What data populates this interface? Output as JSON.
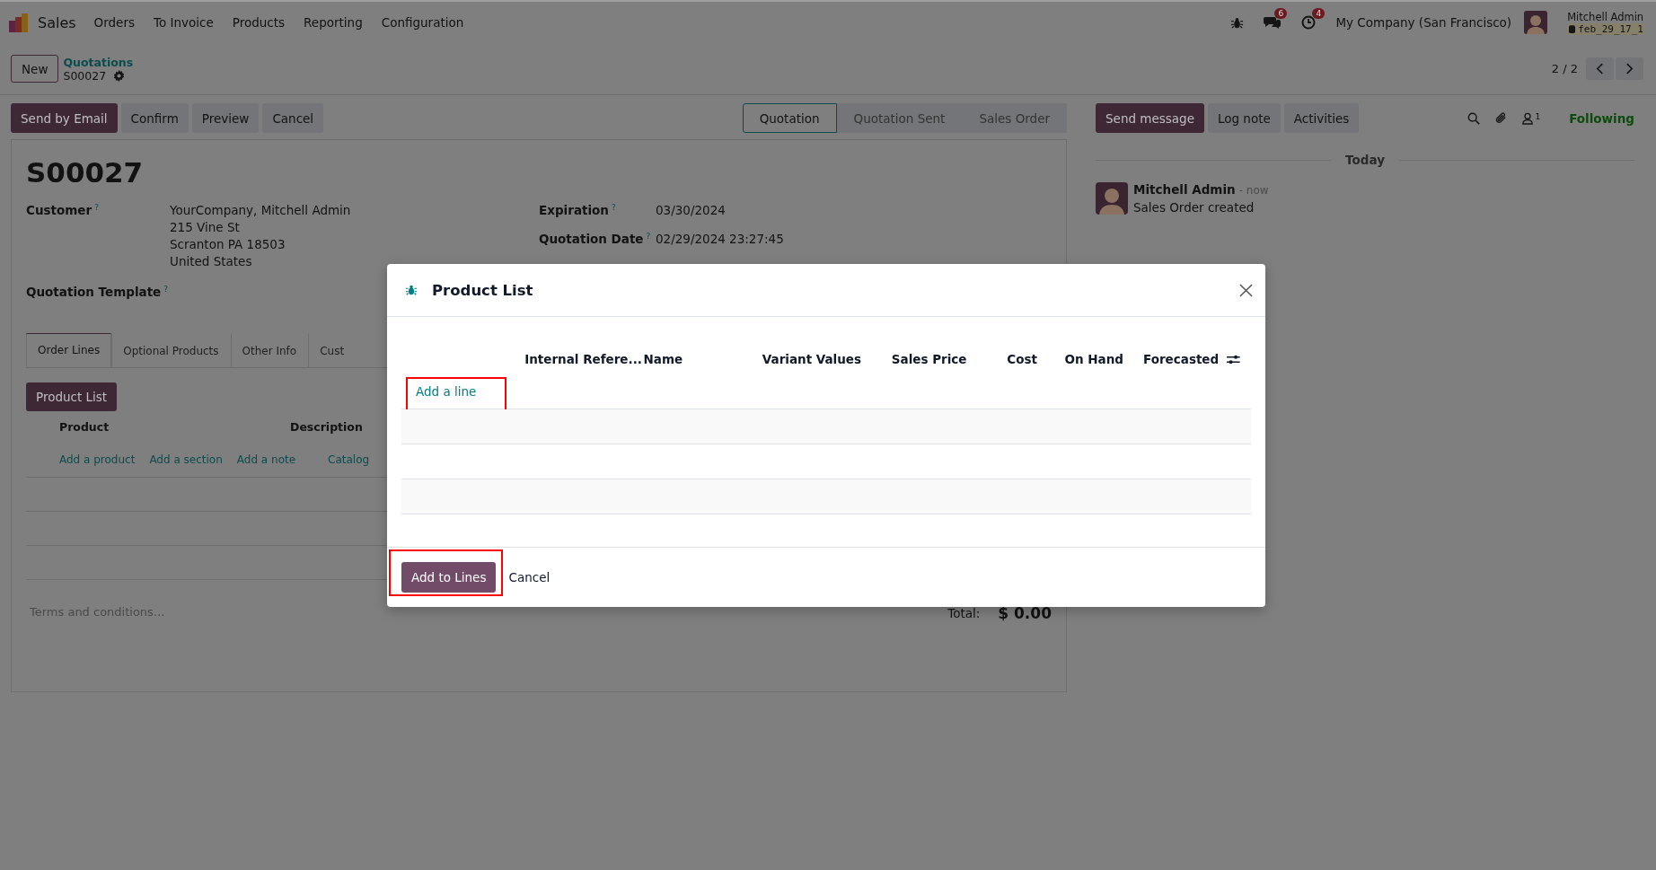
{
  "navbar": {
    "app": "Sales",
    "menu": [
      "Orders",
      "To Invoice",
      "Products",
      "Reporting",
      "Configuration"
    ],
    "chat_count": "6",
    "activity_count": "4",
    "company": "My Company (San Francisco)",
    "user": "Mitchell Admin",
    "database": "feb_29_17_1"
  },
  "control_panel": {
    "new_button": "New",
    "breadcrumb_parent": "Quotations",
    "breadcrumb_current": "S00027",
    "pager": "2 / 2"
  },
  "actions": [
    {
      "label": "Send by Email",
      "kind": "primary"
    },
    {
      "label": "Confirm",
      "kind": "secondary"
    },
    {
      "label": "Preview",
      "kind": "secondary"
    },
    {
      "label": "Cancel",
      "kind": "secondary"
    }
  ],
  "status_steps": [
    {
      "label": "Quotation",
      "selected": true
    },
    {
      "label": "Quotation Sent",
      "selected": false
    },
    {
      "label": "Sales Order",
      "selected": false
    }
  ],
  "form": {
    "title": "S00027",
    "left_fields": [
      {
        "label": "Customer",
        "help": "?",
        "lines": [
          "YourCompany, Mitchell Admin",
          "215 Vine St",
          "Scranton PA 18503",
          "United States"
        ]
      },
      {
        "label": "Quotation Template",
        "help": "?"
      }
    ],
    "right_fields": [
      {
        "label": "Expiration",
        "help": "?",
        "value": "03/30/2024"
      },
      {
        "label": "Quotation Date",
        "help": "?",
        "value": "02/29/2024 23:27:45"
      }
    ],
    "tabs": [
      {
        "label": "Order Lines",
        "selected": true
      },
      {
        "label": "Optional Products",
        "selected": false
      },
      {
        "label": "Other Info",
        "selected": false
      },
      {
        "label": "Cust",
        "selected": false
      }
    ],
    "product_list_button": "Product List",
    "columns": [
      "Product",
      "Description"
    ],
    "add_links": [
      "Add a product",
      "Add a section",
      "Add a note",
      "Catalog"
    ],
    "terms_placeholder": "Terms and conditions...",
    "total_label": "Total:",
    "total": "$ 0.00"
  },
  "chatter": {
    "buttons": [
      {
        "label": "Send message",
        "kind": "primary"
      },
      {
        "label": "Log note",
        "kind": "secondary"
      },
      {
        "label": "Activities",
        "kind": "secondary"
      }
    ],
    "followers_count": "1",
    "follow": "Following",
    "date_divider": "Today",
    "messages": [
      {
        "author": "Mitchell Admin",
        "time": "- now",
        "body": "Sales Order created"
      }
    ]
  },
  "dialog": {
    "title": "Product List",
    "columns": [
      "Internal Refere...",
      "Name",
      "Variant Values",
      "Sales Price",
      "Cost",
      "On Hand",
      "Forecasted"
    ],
    "add_line": "Add a line",
    "buttons": [
      {
        "label": "Add to Lines",
        "kind": "primary"
      },
      {
        "label": "Cancel",
        "kind": "link"
      }
    ]
  }
}
